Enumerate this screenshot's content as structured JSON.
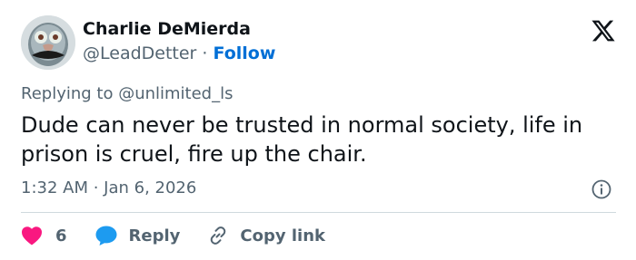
{
  "author": {
    "display_name": "Charlie DeMierda",
    "handle": "@LeadDetter",
    "separator": "·",
    "follow_label": "Follow"
  },
  "reply_context": {
    "text": "Replying to @unlimited_ls"
  },
  "tweet": {
    "text": "Dude can never be trusted in normal society, life in prison is cruel, fire up the chair.",
    "timestamp": "1:32 AM · Jan 6, 2026"
  },
  "actions": {
    "like_count": "6",
    "reply_label": "Reply",
    "copy_link_label": "Copy link"
  },
  "icons": {
    "logo": "x-logo-icon",
    "info": "info-icon",
    "like": "heart-icon",
    "reply": "speech-bubble-icon",
    "copy": "link-icon"
  },
  "colors": {
    "text_primary": "#0f1419",
    "text_secondary": "#536471",
    "follow_blue": "#006fd6",
    "like_pink": "#f91880",
    "reply_blue": "#1d9bf0",
    "divider": "#cfd9de"
  }
}
